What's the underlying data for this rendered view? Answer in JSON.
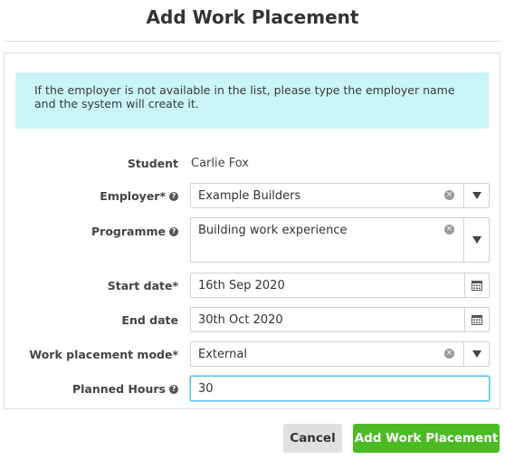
{
  "title": "Add Work Placement",
  "info": "If the employer is not available in the list, please type the employer name and the system will create it.",
  "fields": {
    "student": {
      "label": "Student",
      "value": "Carlie Fox"
    },
    "employer": {
      "label": "Employer*",
      "value": "Example Builders",
      "help_icon": "question-circle-icon"
    },
    "programme": {
      "label": "Programme",
      "value": "Building work experience",
      "help_icon": "question-circle-icon"
    },
    "start_date": {
      "label": "Start date*",
      "value": "16th Sep 2020",
      "icon": "calendar-icon"
    },
    "end_date": {
      "label": "End date",
      "value": "30th Oct 2020",
      "icon": "calendar-icon"
    },
    "mode": {
      "label": "Work placement mode*",
      "value": "External"
    },
    "planned_hours": {
      "label": "Planned Hours",
      "value": "30",
      "help_icon": "question-circle-icon"
    }
  },
  "buttons": {
    "cancel": "Cancel",
    "submit": "Add Work Placement"
  },
  "colors": {
    "info_bg": "#c9f5f7",
    "submit_bg": "#4cbb23",
    "cancel_bg": "#e0e0e0",
    "focus_border": "#4fc3e8"
  }
}
